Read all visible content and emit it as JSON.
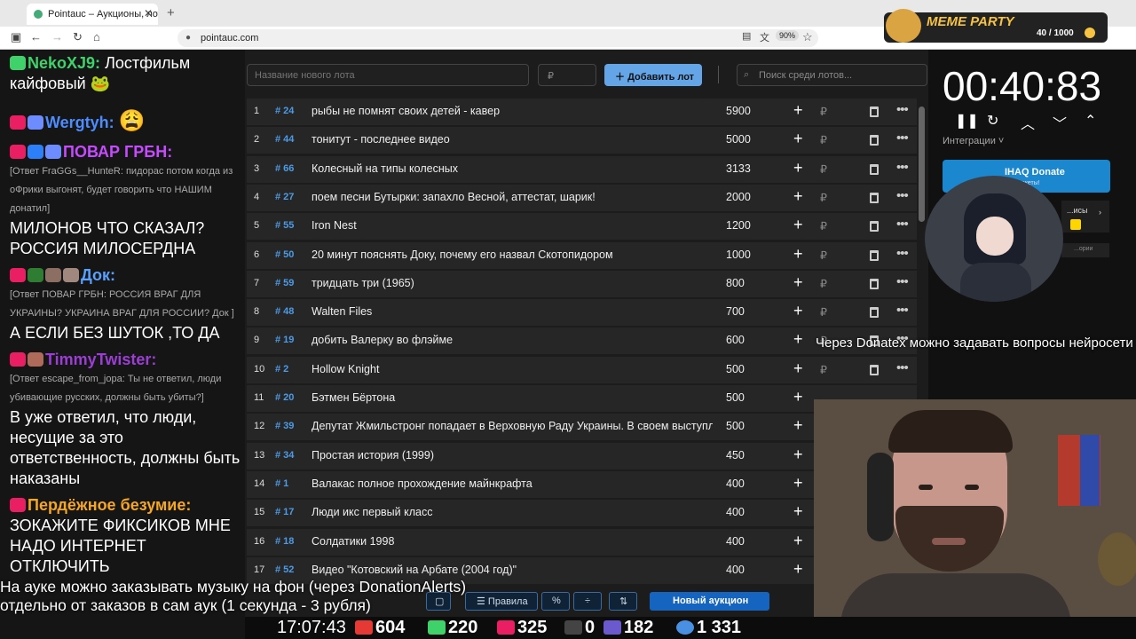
{
  "browser": {
    "tab_title": "Pointauc – Аукционы, лотереи",
    "tab_close": "✕",
    "new_tab": "+",
    "url": "pointauc.com",
    "zoom": "90%"
  },
  "meme_party": {
    "name": "MEME PARTY",
    "points": "40 / 1000"
  },
  "chat": [
    {
      "user": "NekoXJ9:",
      "color": "#3fd26b",
      "text": "Лостфильм кайфовый 🐸"
    },
    {
      "user": "Wergtyh:",
      "color": "#4d8cff",
      "text": "😩"
    },
    {
      "user": "ПОВАР ГРБН:",
      "color": "#c64bff",
      "reply": "[Ответ FraGGs__HunteR: пидорас потом когда из оФрики выгонят, будет говорить что НАШИМ донатил]",
      "text": "МИЛОНОВ ЧТО СКАЗАЛ? РОССИЯ МИЛОСЕРДНА"
    },
    {
      "user": "Док:",
      "color": "#5aa0ff",
      "reply": "[Ответ ПОВАР ГРБН: РОССИЯ ВРАГ ДЛЯ УКРАИНЫ? УКРАИНА ВРАГ ДЛЯ РОССИИ? Док ]",
      "text": "А ЕСЛИ БЕЗ ШУТОК ,ТО ДА"
    },
    {
      "user": "TimmyTwister:",
      "color": "#9c3dd6",
      "reply": "[Ответ escape_from_jopa: Ты не ответил, люди убивающие русских, должны быть убиты?]",
      "text": "В уже ответил, что люди, несущие за это ответственность, должны быть наказаны"
    },
    {
      "user": "Пердёжное безумие:",
      "color": "#f5a623",
      "text": "ЗОКАЖИТЕ ФИКСИКОВ МНЕ НАДО ИНТЕРНЕТ ОТКЛЮЧИТЬ"
    }
  ],
  "toolbar": {
    "new_lot_placeholder": "Название нового лота",
    "price_placeholder": "₽",
    "add_lot": "Добавить лот",
    "search_placeholder": "Поиск среди лотов..."
  },
  "lots": [
    {
      "n": "1",
      "id": "# 24",
      "title": "рыбы не помнят своих детей - кавер",
      "amount": "5900"
    },
    {
      "n": "2",
      "id": "# 44",
      "title": "тонитут - последнее видео",
      "amount": "5000"
    },
    {
      "n": "3",
      "id": "# 66",
      "title": "Колесный на типы колесных",
      "amount": "3133"
    },
    {
      "n": "4",
      "id": "# 27",
      "title": "поем песни Бутырки: запахло Весной, аттестат, шарик!",
      "amount": "2000"
    },
    {
      "n": "5",
      "id": "# 55",
      "title": "Iron Nest",
      "amount": "1200"
    },
    {
      "n": "6",
      "id": "# 50",
      "title": "20 минут пояснять Доку, почему его назвал Скотопидором",
      "amount": "1000"
    },
    {
      "n": "7",
      "id": "# 59",
      "title": "тридцать три (1965)",
      "amount": "800"
    },
    {
      "n": "8",
      "id": "# 48",
      "title": "Walten Files",
      "amount": "700"
    },
    {
      "n": "9",
      "id": "# 19",
      "title": "добить Валерку во флэйме",
      "amount": "600"
    },
    {
      "n": "10",
      "id": "# 2",
      "title": "Hollow Knight",
      "amount": "500"
    },
    {
      "n": "11",
      "id": "# 20",
      "title": "Бэтмен Бёртона",
      "amount": "500"
    },
    {
      "n": "12",
      "id": "# 39",
      "title": "Депутат Жмильстронг попадает в Верховную Раду Украины. В своем выступлении",
      "amount": "500"
    },
    {
      "n": "13",
      "id": "# 34",
      "title": "Простая история (1999)",
      "amount": "450"
    },
    {
      "n": "14",
      "id": "# 1",
      "title": "Валакас полное прохождение майнкрафта",
      "amount": "400"
    },
    {
      "n": "15",
      "id": "# 17",
      "title": "Люди икс первый класс",
      "amount": "400"
    },
    {
      "n": "16",
      "id": "# 18",
      "title": "Солдатики 1998",
      "amount": "400"
    },
    {
      "n": "17",
      "id": "# 52",
      "title": "Видео \"Котовский на Арбате (2004 год)\"",
      "amount": "400"
    }
  ],
  "bottom": {
    "rules": "Правила",
    "percent": "%",
    "new_auction": "Новый аукцион"
  },
  "timer": {
    "value": "00:40:83",
    "integrations": "Интеграции"
  },
  "donate": {
    "title": "IHAQ Donate",
    "subtitle": "...кальные виджеты!",
    "card2": "...исы",
    "card3": "...ории"
  },
  "overlay_text": "Через Donatex можно задавать вопросы нейросети",
  "subtitles": [
    "На ауке можно заказывать музыку на фон (через DonationAlerts)",
    "отдельно от заказов в сам аук (1 секунда - 3 рубля)"
  ],
  "stats": {
    "time": "17:07:43",
    "youtube": "604",
    "kick": "220",
    "live": "325",
    "r": "0",
    "other": "182",
    "viewers": "1 331"
  },
  "colors": {
    "accent": "#64a5e8",
    "id_blue": "#4d9be6",
    "bg": "#1c1c1c",
    "row": "#262626"
  }
}
